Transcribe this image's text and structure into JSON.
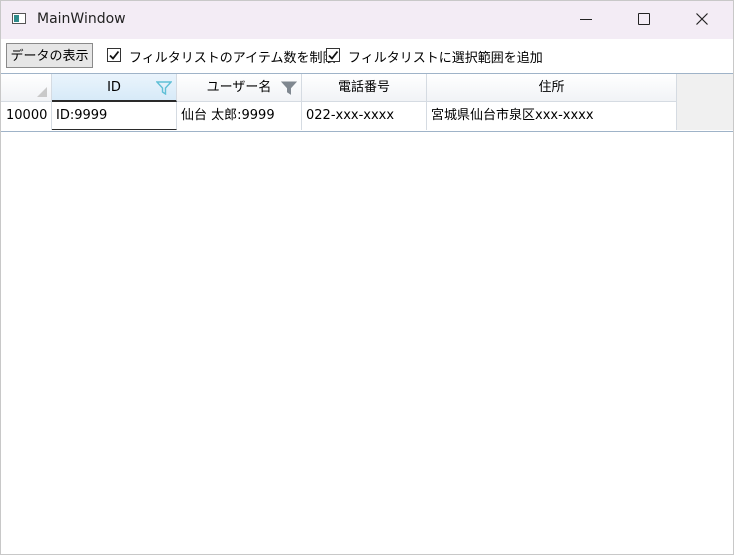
{
  "window": {
    "title": "MainWindow"
  },
  "toolbar": {
    "show_data_button": "データの表示",
    "limit_filter_items": {
      "label": "フィルタリストのアイテム数を制限",
      "checked": true
    },
    "add_selection_range": {
      "label": "フィルタリストに選択範囲を追加",
      "checked": true
    }
  },
  "grid": {
    "columns": [
      "ID",
      "ユーザー名",
      "電話番号",
      "住所"
    ],
    "filtered_columns": [
      "ID",
      "ユーザー名"
    ],
    "rows": [
      {
        "header": "10000",
        "cells": [
          "ID:9999",
          "仙台 太郎:9999",
          "022-xxx-xxxx",
          "宮城県仙台市泉区xxx-xxxx"
        ]
      }
    ]
  },
  "colors": {
    "filter_active": "#5fbfd6",
    "filter_inactive": "#808890"
  }
}
